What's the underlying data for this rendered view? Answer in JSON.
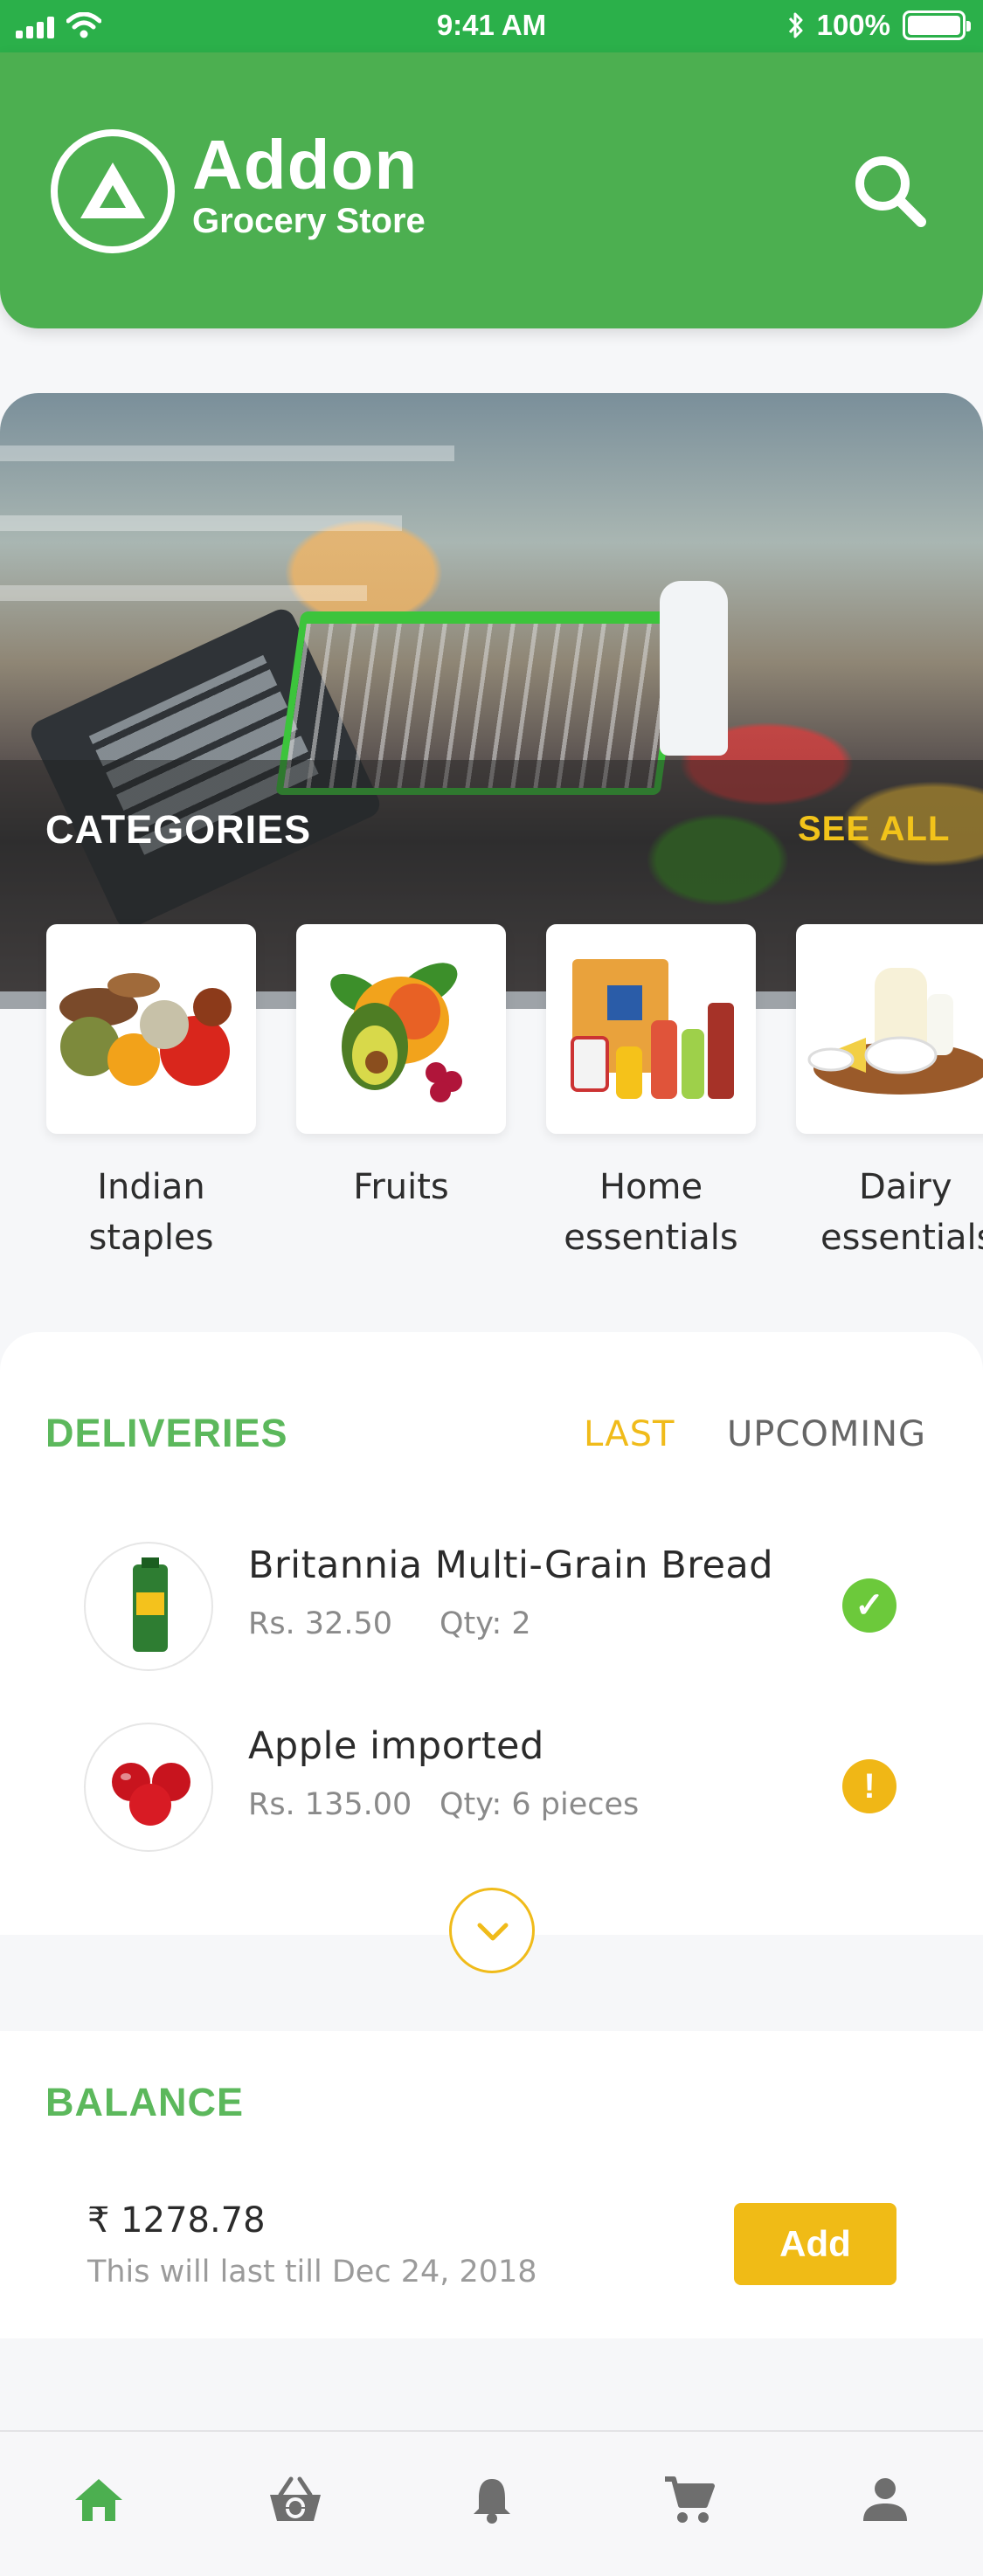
{
  "status_bar": {
    "time": "9:41 AM",
    "battery": "100%"
  },
  "header": {
    "brand_name": "Addon",
    "brand_subtitle": "Grocery Store"
  },
  "categories": {
    "title": "CATEGORIES",
    "see_all": "SEE ALL",
    "items": [
      {
        "line1": "Indian",
        "line2": "staples"
      },
      {
        "line1": "Fruits",
        "line2": ""
      },
      {
        "line1": "Home",
        "line2": "essentials"
      },
      {
        "line1": "Dairy",
        "line2": "essentials"
      }
    ]
  },
  "deliveries": {
    "title": "DELIVERIES",
    "tabs": {
      "last": "LAST",
      "upcoming": "UPCOMING"
    },
    "items": [
      {
        "name": "Britannia Multi-Grain Bread",
        "price": "Rs. 32.50",
        "qty": "Qty: 2",
        "status": "delivered",
        "status_glyph": "✓"
      },
      {
        "name": "Apple imported",
        "price": "Rs. 135.00",
        "qty": "Qty: 6 pieces",
        "status": "warning",
        "status_glyph": "!"
      }
    ]
  },
  "balance": {
    "title": "BALANCE",
    "amount": "₹ 1278.78",
    "note": "This will last till Dec 24, 2018",
    "add_label": "Add"
  },
  "nav": {
    "items": [
      "home-icon",
      "basket-icon",
      "bell-icon",
      "cart-icon",
      "profile-icon"
    ],
    "active": "home-icon"
  },
  "colors": {
    "primary_green": "#4caf50",
    "accent_yellow": "#f0bb1a",
    "ok_green": "#6cc93b",
    "warn_amber": "#f0b716"
  }
}
